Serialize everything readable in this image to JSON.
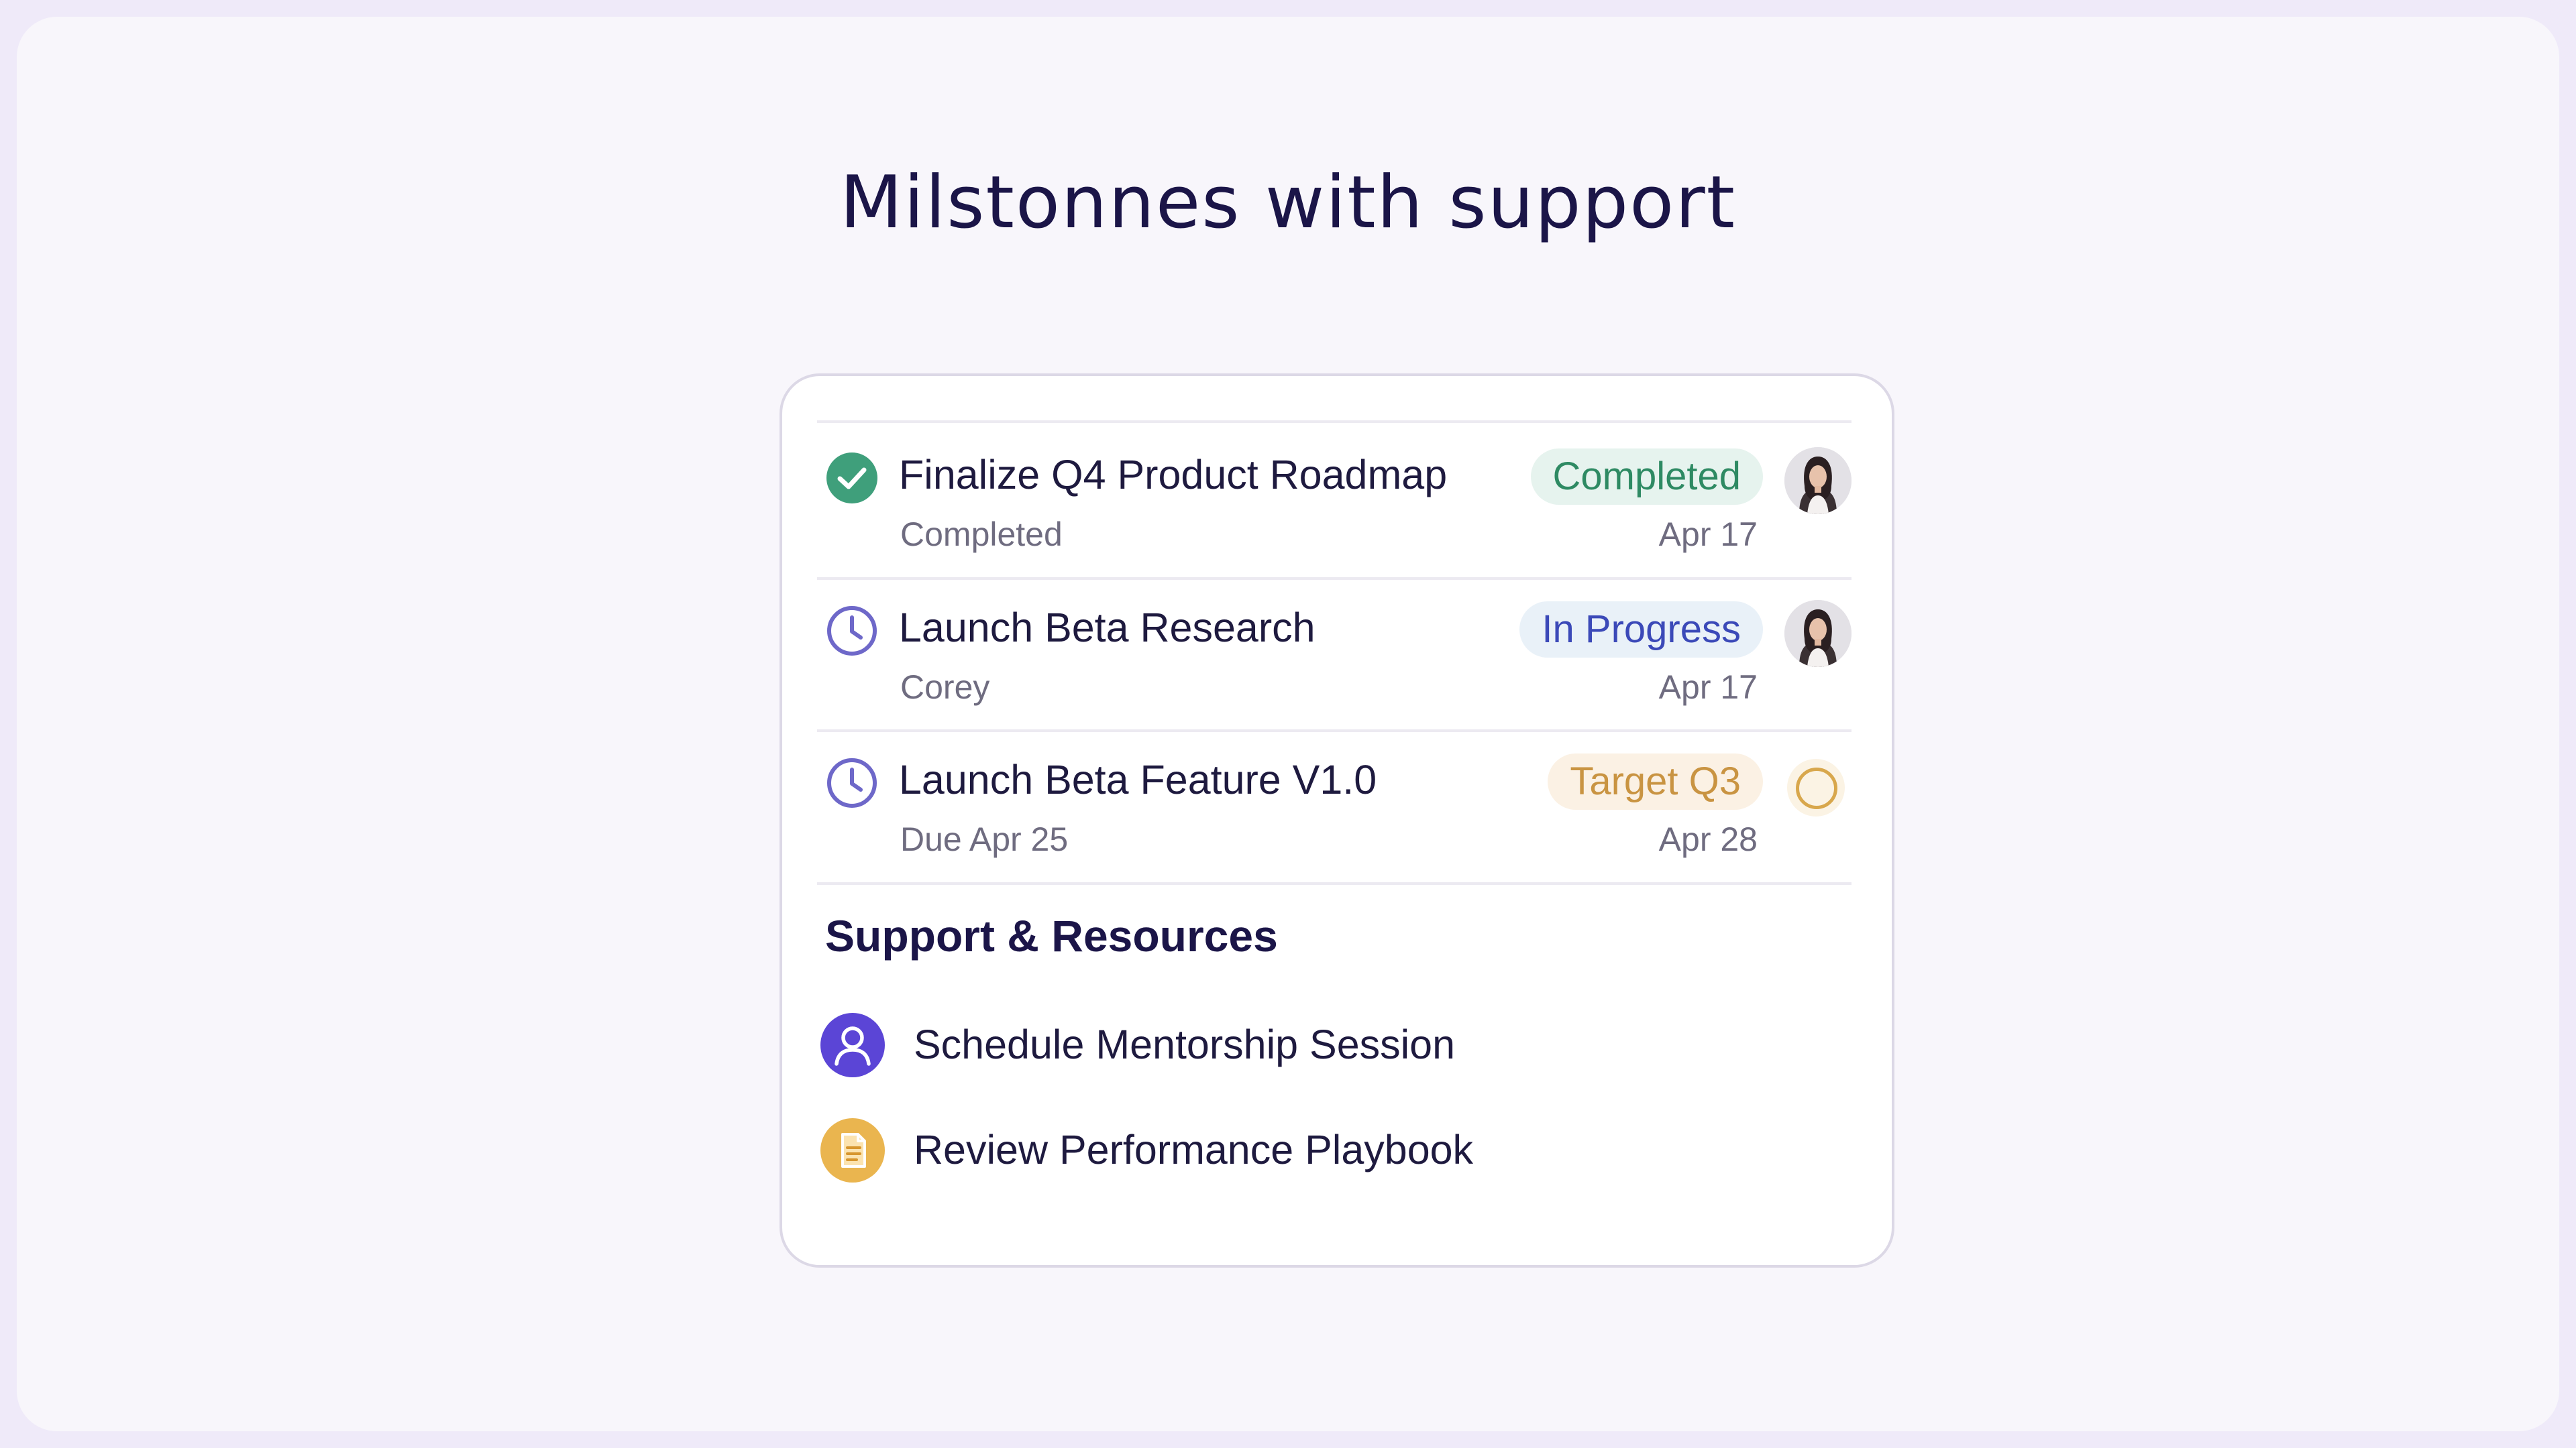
{
  "page": {
    "title": "Milstonnes with support"
  },
  "milestones": [
    {
      "title": "Finalize Q4 Product Roadmap",
      "subtitle": "Completed",
      "status": "Completed",
      "date": "Apr 17",
      "icon": "check-circle-icon",
      "owner": "avatar"
    },
    {
      "title": "Launch Beta Research",
      "subtitle": "Corey",
      "status": "In Progress",
      "date": "Apr 17",
      "icon": "clock-icon",
      "owner": "avatar"
    },
    {
      "title": "Launch Beta Feature V1.0",
      "subtitle": "Due Apr 25",
      "status": "Target Q3",
      "date": "Apr 28",
      "icon": "clock-icon",
      "owner": "empty"
    }
  ],
  "support": {
    "title": "Support & Resources",
    "items": [
      {
        "label": "Schedule Mentorship Session",
        "icon": "user-icon",
        "color": "#5b45d6"
      },
      {
        "label": "Review Performance Playbook",
        "icon": "document-icon",
        "color": "#eab54f"
      }
    ]
  },
  "colors": {
    "completed": "#2e8a63",
    "in_progress": "#3b49b8",
    "target": "#c99442",
    "clock": "#6e68c9"
  }
}
